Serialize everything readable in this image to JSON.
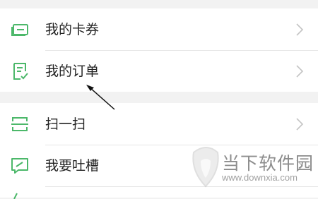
{
  "menu": {
    "section1": [
      {
        "label": "我的卡券",
        "icon": "card-coupon-icon"
      },
      {
        "label": "我的订单",
        "icon": "order-list-icon"
      }
    ],
    "section2": [
      {
        "label": "扫一扫",
        "icon": "scan-icon"
      },
      {
        "label": "我要吐槽",
        "icon": "feedback-icon"
      }
    ]
  },
  "colors": {
    "icon_green": "#4cb86a",
    "chevron_gray": "#c4c4c4",
    "section_gap": "#f2f2f2"
  },
  "watermark": {
    "name": "当下软件园",
    "url": "www.downxia.com"
  }
}
